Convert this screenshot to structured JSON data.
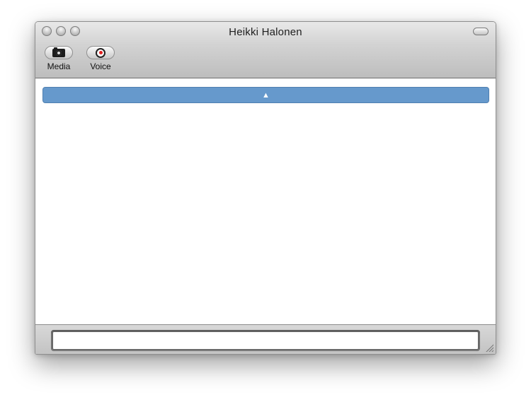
{
  "window": {
    "title": "Heikki Halonen"
  },
  "toolbar": {
    "media_label": "Media",
    "voice_label": "Voice"
  },
  "history_bar": {
    "arrow": "▲"
  },
  "message_input": {
    "value": "",
    "placeholder": ""
  },
  "colors": {
    "history_bar": "#6699cc",
    "record_dot": "#e02020"
  },
  "icons": {
    "media": "camera-icon",
    "voice": "record-icon"
  }
}
